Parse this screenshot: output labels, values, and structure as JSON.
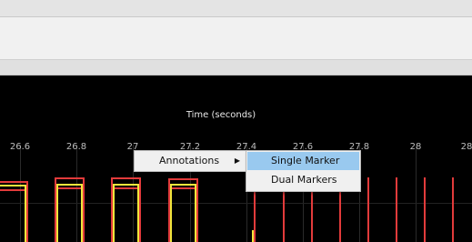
{
  "chart_data": {
    "type": "line",
    "xlabel": "Time (seconds)",
    "xticks": [
      "26.6",
      "26.8",
      "27",
      "27.2",
      "27.4",
      "27.6",
      "27.8",
      "28",
      "28"
    ]
  },
  "context_menu": {
    "item": "Annotations",
    "submenu": [
      "Single Marker",
      "Dual Markers"
    ]
  },
  "colors": {
    "series_yellow": "#f0e63c",
    "series_red": "#e23b3b",
    "menu_highlight": "#99c9ef"
  }
}
